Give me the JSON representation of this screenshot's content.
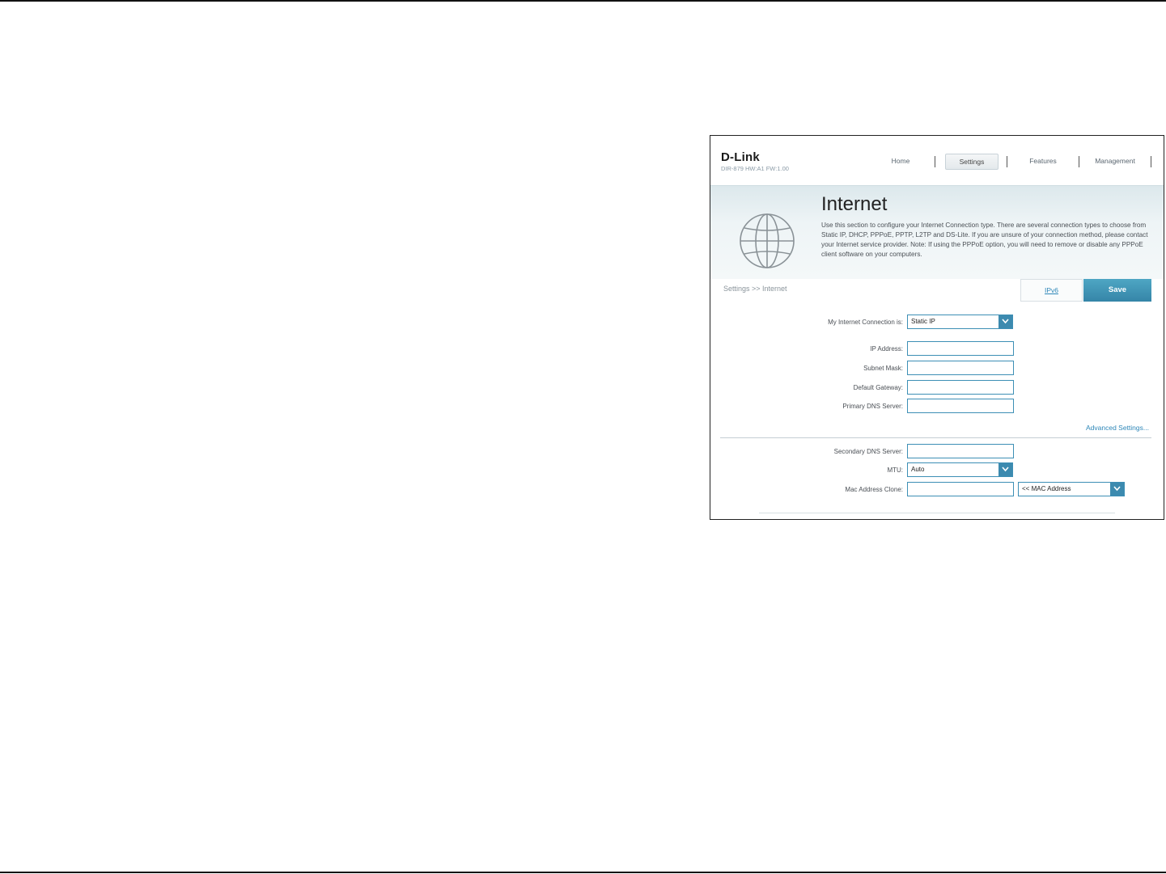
{
  "header": {
    "logo": "D-Link",
    "model": "DIR-879 HW:A1 FW:1.00",
    "nav": [
      {
        "label": "Home",
        "active": false
      },
      {
        "label": "Settings",
        "active": true
      },
      {
        "label": "Features",
        "active": false
      },
      {
        "label": "Management",
        "active": false
      }
    ]
  },
  "banner": {
    "title": "Internet",
    "description": "Use this section to configure your Internet Connection type. There are several connection types to choose from Static IP, DHCP, PPPoE, PPTP, L2TP and DS-Lite. If you are unsure of your connection method, please contact your Internet service provider. Note: If using the PPPoE option, you will need to remove or disable any PPPoE client software on your computers.",
    "icon": "globe-icon"
  },
  "toolbar": {
    "breadcrumb": "Settings >> Internet",
    "ipv6_label": "IPv6",
    "save_label": "Save"
  },
  "form": {
    "connection_label": "My Internet Connection is:",
    "connection_value": "Static IP",
    "ip_label": "IP Address:",
    "ip_value": "",
    "subnet_label": "Subnet Mask:",
    "subnet_value": "",
    "gateway_label": "Default Gateway:",
    "gateway_value": "",
    "dns1_label": "Primary DNS Server:",
    "dns1_value": "",
    "advanced_link": "Advanced Settings...",
    "dns2_label": "Secondary DNS Server:",
    "dns2_value": "",
    "mtu_label": "MTU:",
    "mtu_value": "Auto",
    "mac_label": "Mac Address Clone:",
    "mac_value": "",
    "mac_select_value": "<< MAC Address"
  },
  "colors": {
    "accent": "#3c8aaf",
    "link": "#2e87b8",
    "save": "#3585a8"
  }
}
